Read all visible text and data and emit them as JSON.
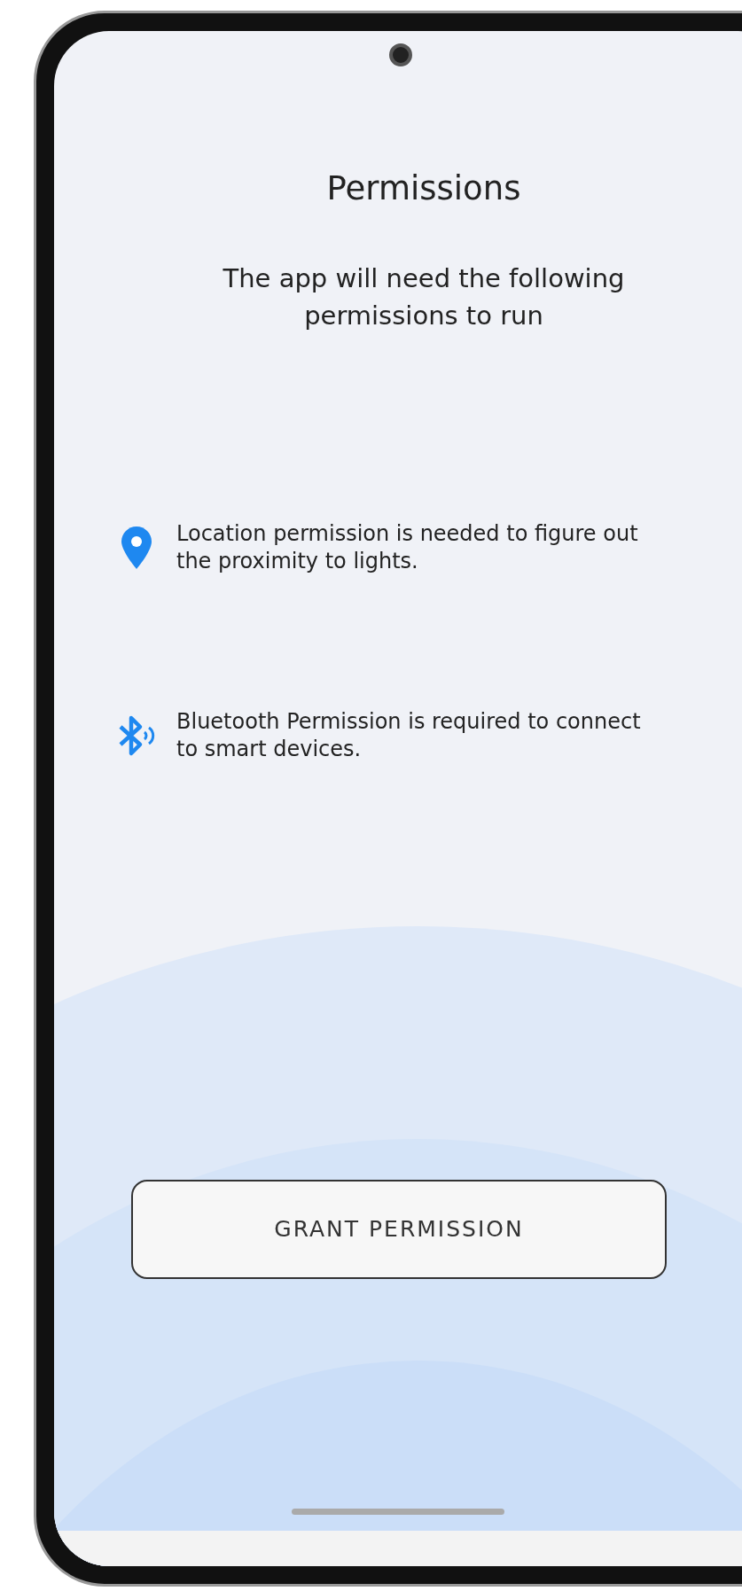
{
  "screen": {
    "title": "Permissions",
    "subtitle": "The app will need the following permissions to run"
  },
  "permissions": [
    {
      "kind": "location",
      "text": "Location permission is needed to figure out the proximity to lights."
    },
    {
      "kind": "bluetooth",
      "text": "Bluetooth Permission is required to connect to smart devices."
    }
  ],
  "button": {
    "label": "GRANT PERMISSION"
  }
}
